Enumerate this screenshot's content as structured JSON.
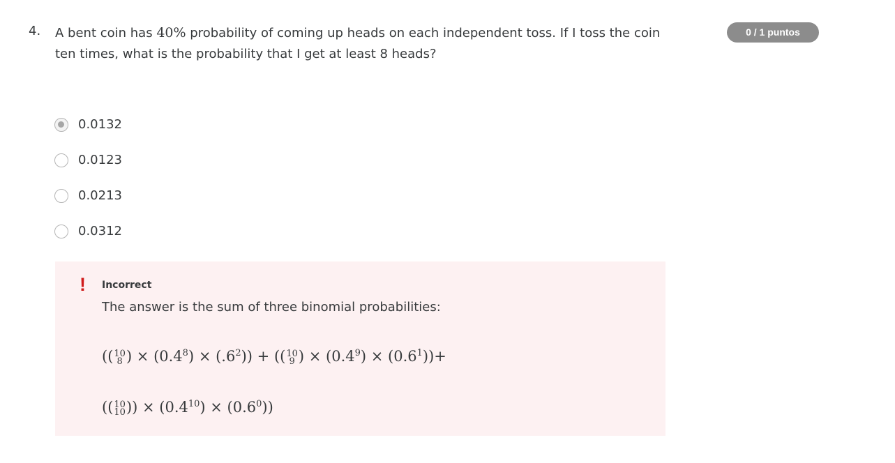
{
  "question": {
    "number": "4.",
    "text_before": "A bent coin has ",
    "math_value": "40%",
    "text_after": " probability of coming up heads on each independent toss. If I toss the coin ten times, what is the probability that I get at least 8 heads?",
    "score_badge": "0 / 1 puntos"
  },
  "options": [
    {
      "label": "0.0132",
      "selected": true
    },
    {
      "label": "0.0123",
      "selected": false
    },
    {
      "label": "0.0213",
      "selected": false
    },
    {
      "label": "0.0312",
      "selected": false
    }
  ],
  "feedback": {
    "icon": "!",
    "status": "Incorrect",
    "explanation": "The answer is the sum of three binomial probabilities:",
    "formula_line1": {
      "p1": "((",
      "b1_top": "10",
      "b1_bot": "8",
      "p2": ") × (0.4",
      "e1": "8",
      "p3": ") × (.6",
      "e2": "2",
      "p4": ")) + ((",
      "b2_top": "10",
      "b2_bot": "9",
      "p5": ") × (0.4",
      "e3": "9",
      "p6": ") × (0.6",
      "e4": "1",
      "p7": "))+"
    },
    "formula_line2": {
      "p1": "((",
      "b1_top": "10",
      "b1_bot": "10",
      "p2": ")) × (0.4",
      "e1": "10",
      "p3": ") × (0.6",
      "e2": "0",
      "p4": "))"
    },
    "colors": {
      "background": "#fdf1f2",
      "icon": "#d01b1b",
      "badge": "#8c8c8c"
    }
  }
}
